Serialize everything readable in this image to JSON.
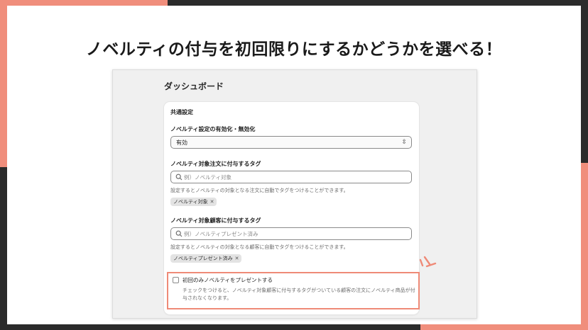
{
  "headline": "ノベルティの付与を初回限りにするかどうかを選べる！",
  "dashboard": {
    "page_title": "ダッシュボード",
    "card_title": "共通設定",
    "enable": {
      "label": "ノベルティ設定の有効化・無効化",
      "value": "有効"
    },
    "order_tag": {
      "label": "ノベルティ対象注文に付与するタグ",
      "placeholder": "例）ノベルティ対象",
      "help": "設定するとノベルティの対象となる注文に自動でタグをつけることができます。",
      "tag": "ノベルティ対象"
    },
    "customer_tag": {
      "label": "ノベルティ対象顧客に付与するタグ",
      "placeholder": "例）ノベルティプレゼント済み",
      "help": "設定するとノベルティの対象となる顧客に自動でタグをつけることができます。",
      "tag": "ノベルティプレゼント済み"
    },
    "first_only": {
      "label": "初回のみノベルティをプレゼントする",
      "help": "チェックをつけると、ノベルティ対象顧客に付与するタグがついている顧客の注文にノベルティ商品が付与されなくなります。",
      "checked": false
    }
  },
  "icons": {
    "select": "chevron-up-down-icon",
    "search": "search-icon",
    "remove": "close-icon",
    "sparkle": "sparkle-icon"
  },
  "colors": {
    "accent": "#ef8a77",
    "frame": "#2b2b2b"
  }
}
